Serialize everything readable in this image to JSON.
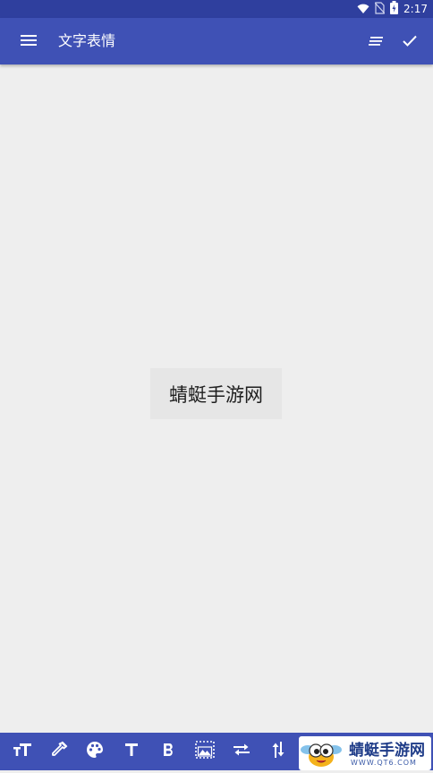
{
  "status_bar": {
    "time": "2:17",
    "icons": [
      "wifi-icon",
      "no-sim-icon",
      "battery-icon"
    ]
  },
  "app_bar": {
    "title": "文字表情",
    "menu_icon": "hamburger-menu-icon",
    "align_icon": "text-align-icon",
    "done_icon": "checkmark-icon"
  },
  "canvas": {
    "preview_text": "蜻蜓手游网"
  },
  "toolbar": {
    "items": [
      "text-size-icon",
      "eyedropper-icon",
      "palette-icon",
      "font-icon",
      "bold-icon",
      "background-image-icon",
      "swap-horizontal-icon",
      "swap-vertical-icon"
    ]
  },
  "watermark": {
    "title": "蜻蜓手游网",
    "url": "WWW.QT6.COM"
  },
  "colors": {
    "primary": "#3f51b5",
    "primary_dark": "#2f3f9e",
    "background": "#eeeeee"
  }
}
